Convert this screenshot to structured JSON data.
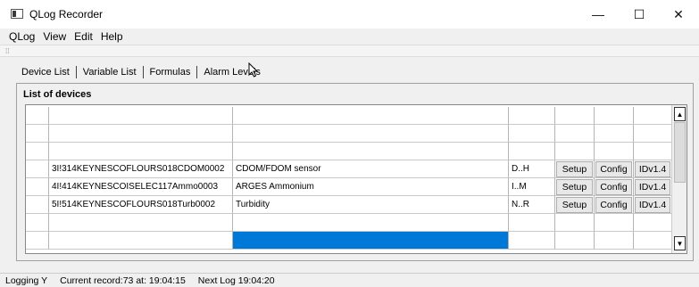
{
  "window": {
    "title": "QLog Recorder",
    "controls": {
      "minimize": "—",
      "maximize": "☐",
      "close": "✕"
    }
  },
  "menu": [
    "QLog",
    "View",
    "Edit",
    "Help"
  ],
  "tabs": [
    "Device List",
    "Variable List",
    "Formulas",
    "Alarm Levels"
  ],
  "active_tab": "Device List",
  "panel": {
    "title": "List of devices"
  },
  "devices": [
    {
      "id": "",
      "name": "",
      "range": "",
      "setup": "",
      "config": "",
      "version": ""
    },
    {
      "id": "",
      "name": "",
      "range": "",
      "setup": "",
      "config": "",
      "version": ""
    },
    {
      "id": "",
      "name": "",
      "range": "",
      "setup": "",
      "config": "",
      "version": ""
    },
    {
      "id": "3I!314KEYNESCOFLOURS018CDOM0002",
      "name": "CDOM/FDOM sensor",
      "range": "D..H",
      "setup": "Setup",
      "config": "Config",
      "version": "IDv1.4"
    },
    {
      "id": "4I!414KEYNESCOISELEC117Ammo0003",
      "name": "ARGES Ammonium",
      "range": "I..M",
      "setup": "Setup",
      "config": "Config",
      "version": "IDv1.4"
    },
    {
      "id": "5I!514KEYNESCOFLOURS018Turb0002",
      "name": "Turbidity",
      "range": "N..R",
      "setup": "Setup",
      "config": "Config",
      "version": "IDv1.4"
    },
    {
      "id": "",
      "name": "",
      "range": "",
      "setup": "",
      "config": "",
      "version": ""
    },
    {
      "id": "",
      "name": "",
      "range": "",
      "setup": "",
      "config": "",
      "version": ""
    }
  ],
  "status": {
    "logging": "Logging Y",
    "current_record": "Current record:73 at: 19:04:15",
    "next_log": "Next Log 19:04:20"
  },
  "colors": {
    "selection": "#0078d7"
  }
}
